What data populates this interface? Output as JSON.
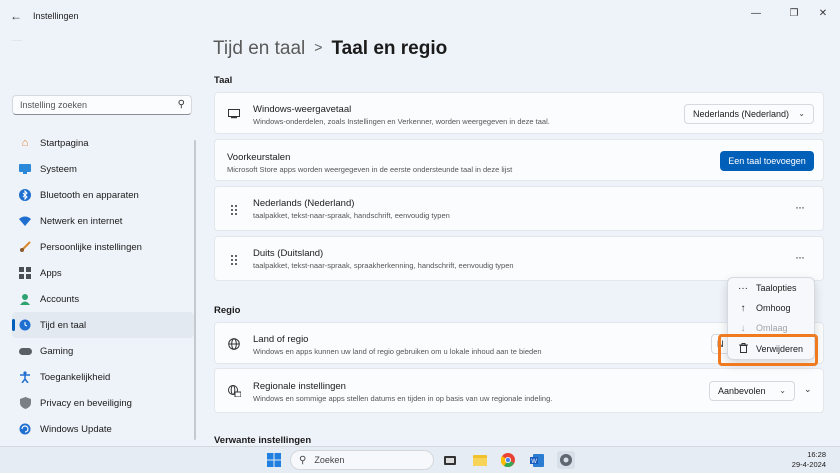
{
  "window": {
    "title": "Instellingen",
    "back_icon": "arrow-left-icon"
  },
  "search": {
    "placeholder": "Instelling zoeken"
  },
  "sidebar": {
    "items": [
      {
        "label": "Startpagina",
        "icon": "home-icon",
        "color": "#e8812e"
      },
      {
        "label": "Systeem",
        "icon": "system-icon",
        "color": "#2b88d8"
      },
      {
        "label": "Bluetooth en apparaten",
        "icon": "bluetooth-icon",
        "color": "#1f6fd1"
      },
      {
        "label": "Netwerk en internet",
        "icon": "wifi-icon",
        "color": "#1f6fd1"
      },
      {
        "label": "Persoonlijke instellingen",
        "icon": "brush-icon",
        "color": "#d8862b"
      },
      {
        "label": "Apps",
        "icon": "apps-icon",
        "color": "#4a4f56"
      },
      {
        "label": "Accounts",
        "icon": "person-icon",
        "color": "#2ea36f"
      },
      {
        "label": "Tijd en taal",
        "icon": "globe-clock-icon",
        "color": "#1f6fd1",
        "active": true
      },
      {
        "label": "Gaming",
        "icon": "gamepad-icon",
        "color": "#5a5f66"
      },
      {
        "label": "Toegankelijkheid",
        "icon": "accessibility-icon",
        "color": "#1f6fd1"
      },
      {
        "label": "Privacy en beveiliging",
        "icon": "shield-icon",
        "color": "#7a7f86"
      },
      {
        "label": "Windows Update",
        "icon": "update-icon",
        "color": "#1f6fd1"
      }
    ]
  },
  "breadcrumb": {
    "parent": "Tijd en taal",
    "separator": ">",
    "current": "Taal en regio"
  },
  "sections": {
    "taal": "Taal",
    "regio": "Regio",
    "verwante": "Verwante instellingen"
  },
  "display_language": {
    "title": "Windows-weergavetaal",
    "subtitle": "Windows-onderdelen, zoals Instellingen en Verkenner, worden weergegeven in deze taal.",
    "value": "Nederlands (Nederland)"
  },
  "preferred": {
    "title": "Voorkeurstalen",
    "subtitle": "Microsoft Store apps worden weergegeven in de eerste ondersteunde taal in deze lijst",
    "button": "Een taal toevoegen"
  },
  "languages": [
    {
      "title": "Nederlands (Nederland)",
      "subtitle": "taalpakket, tekst-naar-spraak, handschrift, eenvoudig typen"
    },
    {
      "title": "Duits (Duitsland)",
      "subtitle": "taalpakket, tekst-naar-spraak, spraakherkenning, handschrift, eenvoudig typen"
    }
  ],
  "region": {
    "title": "Land of regio",
    "subtitle": "Windows en apps kunnen uw land of regio gebruiken om u lokale inhoud aan te bieden",
    "value_partial": "N"
  },
  "regional_format": {
    "title": "Regionale instellingen",
    "subtitle": "Windows en sommige apps stellen datums en tijden in op basis van uw regionale indeling.",
    "value": "Aanbevolen"
  },
  "context_menu": {
    "items": [
      {
        "label": "Taalopties",
        "icon": "more-icon"
      },
      {
        "label": "Omhoog",
        "icon": "arrow-up-icon"
      },
      {
        "label": "Omlaag",
        "icon": "arrow-down-icon",
        "disabled": true
      },
      {
        "label": "Verwijderen",
        "icon": "trash-icon"
      }
    ],
    "highlight_color": "#ef7a1f"
  },
  "taskbar": {
    "search": "Zoeken",
    "time": "16:28",
    "date": "29-4-2024"
  },
  "colors": {
    "accent": "#005fb8",
    "background": "#eef3f9"
  }
}
